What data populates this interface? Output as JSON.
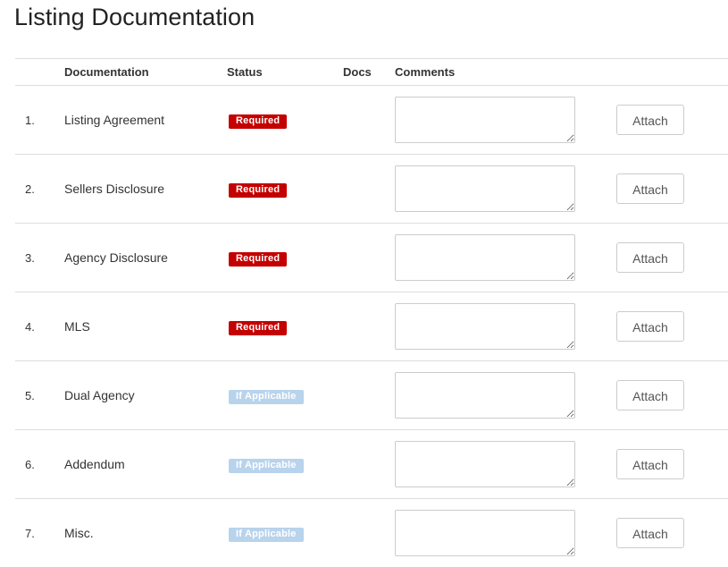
{
  "page": {
    "title": "Listing Documentation"
  },
  "table": {
    "headers": {
      "number": "",
      "documentation": "Documentation",
      "status": "Status",
      "docs": "Docs",
      "comments": "Comments",
      "action": ""
    },
    "rows": [
      {
        "number": "1.",
        "documentation": "Listing Agreement",
        "status": "Required",
        "status_type": "required",
        "docs": "",
        "comments": "",
        "action_label": "Attach"
      },
      {
        "number": "2.",
        "documentation": "Sellers Disclosure",
        "status": "Required",
        "status_type": "required",
        "docs": "",
        "comments": "",
        "action_label": "Attach"
      },
      {
        "number": "3.",
        "documentation": "Agency Disclosure",
        "status": "Required",
        "status_type": "required",
        "docs": "",
        "comments": "",
        "action_label": "Attach"
      },
      {
        "number": "4.",
        "documentation": "MLS",
        "status": "Required",
        "status_type": "required",
        "docs": "",
        "comments": "",
        "action_label": "Attach"
      },
      {
        "number": "5.",
        "documentation": "Dual Agency",
        "status": "If Applicable",
        "status_type": "optional",
        "docs": "",
        "comments": "",
        "action_label": "Attach"
      },
      {
        "number": "6.",
        "documentation": "Addendum",
        "status": "If Applicable",
        "status_type": "optional",
        "docs": "",
        "comments": "",
        "action_label": "Attach"
      },
      {
        "number": "7.",
        "documentation": "Misc.",
        "status": "If Applicable",
        "status_type": "optional",
        "docs": "",
        "comments": "",
        "action_label": "Attach"
      }
    ]
  },
  "colors": {
    "required_badge": "#c40000",
    "optional_badge": "#b8d3ec",
    "border": "#dddddd"
  }
}
